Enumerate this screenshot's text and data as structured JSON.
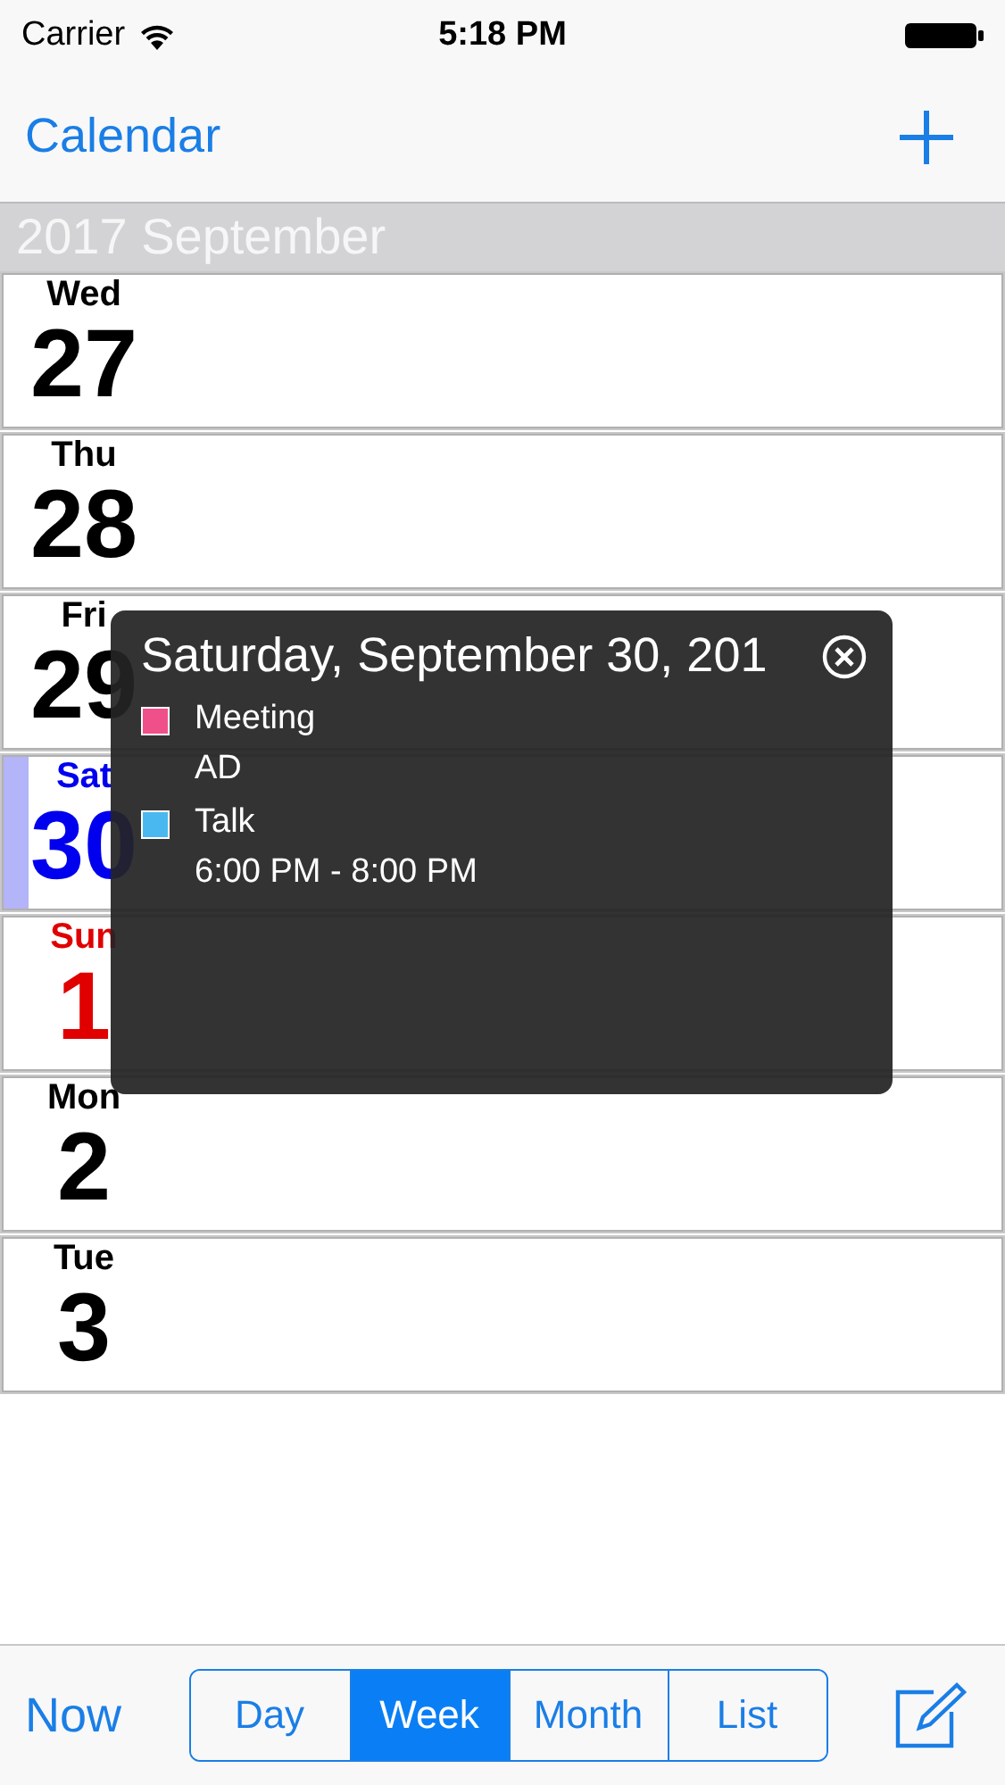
{
  "status_bar": {
    "carrier": "Carrier",
    "time": "5:18 PM"
  },
  "nav_bar": {
    "title": "Calendar"
  },
  "month_header": "2017 September",
  "days": [
    {
      "weekday": "Wed",
      "date": "27",
      "kind": "weekday",
      "selected": false
    },
    {
      "weekday": "Thu",
      "date": "28",
      "kind": "weekday",
      "selected": false
    },
    {
      "weekday": "Fri",
      "date": "29",
      "kind": "weekday",
      "selected": false
    },
    {
      "weekday": "Sat",
      "date": "30",
      "kind": "saturday",
      "selected": true
    },
    {
      "weekday": "Sun",
      "date": "1",
      "kind": "sunday",
      "selected": false
    },
    {
      "weekday": "Mon",
      "date": "2",
      "kind": "weekday",
      "selected": false
    },
    {
      "weekday": "Tue",
      "date": "3",
      "kind": "weekday",
      "selected": false
    }
  ],
  "popup": {
    "title": "Saturday, September 30, 201",
    "events": [
      {
        "title": "Meeting",
        "detail": "AD",
        "color": "#f0508a"
      },
      {
        "title": "Talk",
        "detail": "6:00 PM - 8:00 PM",
        "color": "#4ab8f0"
      }
    ]
  },
  "toolbar": {
    "now": "Now",
    "segments": [
      {
        "label": "Day",
        "selected": false
      },
      {
        "label": "Week",
        "selected": true
      },
      {
        "label": "Month",
        "selected": false
      },
      {
        "label": "List",
        "selected": false
      }
    ]
  }
}
